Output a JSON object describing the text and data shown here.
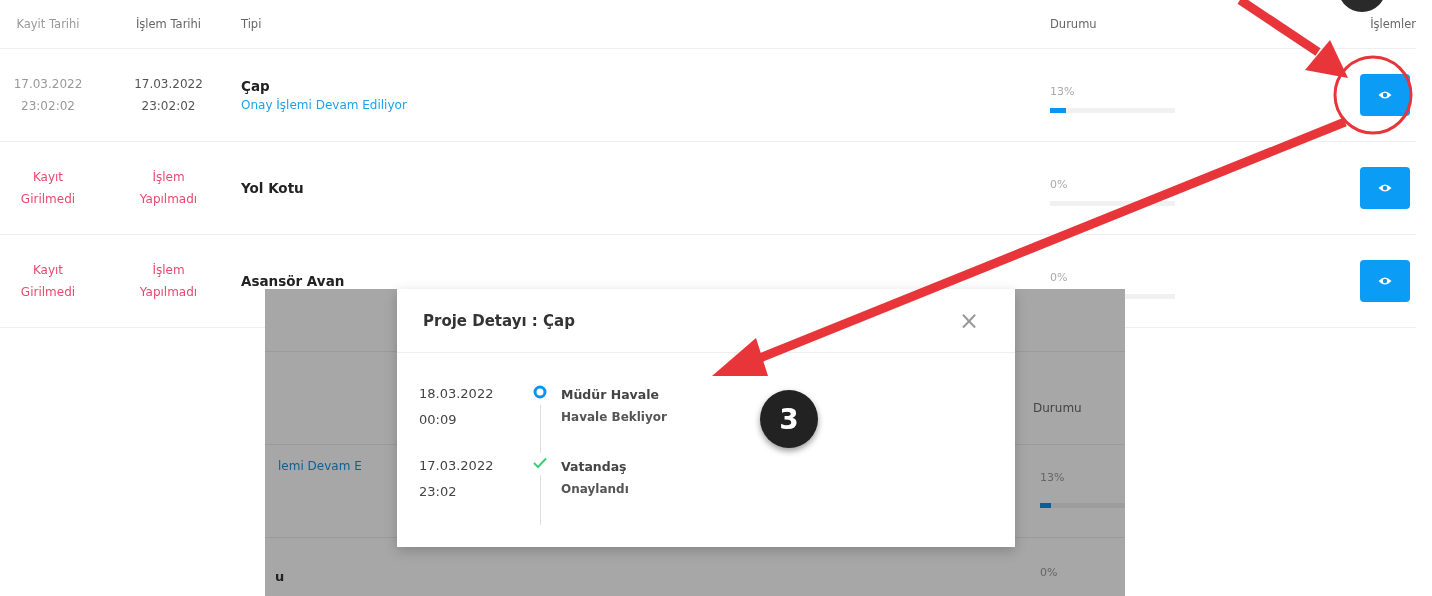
{
  "table": {
    "columns": [
      "Kayit Tarihi",
      "İşlem Tarihi",
      "Tipi",
      "Durumu",
      "İşlemler"
    ],
    "rows": [
      {
        "kayit": {
          "kind": "date",
          "lines": [
            "17.03.2022",
            "23:02:02"
          ]
        },
        "islem": {
          "kind": "date",
          "lines": [
            "17.03.2022",
            "23:02:02"
          ]
        },
        "type": "Çap",
        "subtitle": "Onay İşlemi Devam Ediliyor",
        "reading": "13%",
        "level": 0.13
      },
      {
        "kayit": {
          "kind": "missing",
          "lines": [
            "Kayıt",
            "Girilmedi"
          ]
        },
        "islem": {
          "kind": "missing",
          "lines": [
            "İşlem",
            "Yapılmadı"
          ]
        },
        "type": "Yol Kotu",
        "reading": "0%",
        "level": 0
      },
      {
        "kayit": {
          "kind": "missing",
          "lines": [
            "Kayıt",
            "Girilmedi"
          ]
        },
        "islem": {
          "kind": "missing",
          "lines": [
            "İşlem",
            "Yapılmadı"
          ]
        },
        "type": "Asansör Avan",
        "reading": "0%",
        "level": 0
      }
    ]
  },
  "inset": {
    "header": "Durumu",
    "rows": [
      {
        "subtitle": "lemi Devam E",
        "reading": "13%",
        "level": 0.13
      },
      {
        "type": "u",
        "reading": "0%"
      }
    ]
  },
  "modal": {
    "title": "Proje Detayı : Çap",
    "close": "×",
    "timeline": [
      {
        "kind": "pending",
        "date": "18.03.2022",
        "time": "00:09",
        "title": "Müdür Havale",
        "note": "Havale Bekliyor"
      },
      {
        "kind": "done",
        "date": "17.03.2022",
        "time": "23:02",
        "title": "Vatandaş",
        "note": "Onaylandı"
      }
    ]
  },
  "annotation": {
    "badge": "3"
  }
}
